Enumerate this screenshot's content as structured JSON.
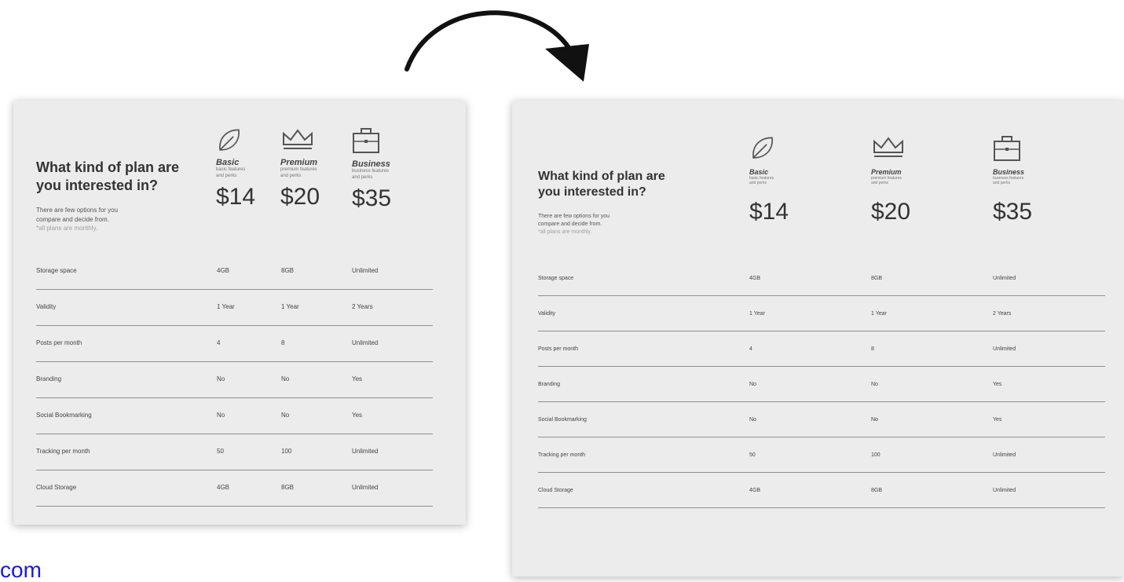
{
  "heading_line1": "What kind of plan are",
  "heading_line2": "you interested in?",
  "intro_line1": "There are few options for you",
  "intro_line2": "compare and decide from.",
  "intro_note": "*all plans are monthly.",
  "plans": [
    {
      "name": "Basic",
      "desc_line1": "basic features",
      "desc_line2": "and perks",
      "price": "$14",
      "icon": "leaf-icon"
    },
    {
      "name": "Premium",
      "desc_line1": "premium features",
      "desc_line2": "and perks",
      "price": "$20",
      "icon": "crown-icon"
    },
    {
      "name": "Business",
      "desc_line1": "business features",
      "desc_line2": "and perks",
      "price": "$35",
      "icon": "briefcase-icon"
    }
  ],
  "rows": [
    {
      "label": "Storage space",
      "basic": "4GB",
      "premium": "8GB",
      "business": "Unlimited"
    },
    {
      "label": "Validity",
      "basic": "1 Year",
      "premium": "1 Year",
      "business": "2 Years"
    },
    {
      "label": "Posts per month",
      "basic": "4",
      "premium": "8",
      "business": "Unlimited"
    },
    {
      "label": "Branding",
      "basic": "No",
      "premium": "No",
      "business": "Yes"
    },
    {
      "label": "Social Bookmarking",
      "basic": "No",
      "premium": "No",
      "business": "Yes"
    },
    {
      "label": "Tracking per month",
      "basic": "50",
      "premium": "100",
      "business": "Unlimited"
    },
    {
      "label": "Cloud Storage",
      "basic": "4GB",
      "premium": "8GB",
      "business": "Unlimited"
    }
  ],
  "footer_link": "com",
  "colors": {
    "card_bg": "#ececec",
    "divider": "#8f8f8f",
    "link": "#1a1adc"
  }
}
